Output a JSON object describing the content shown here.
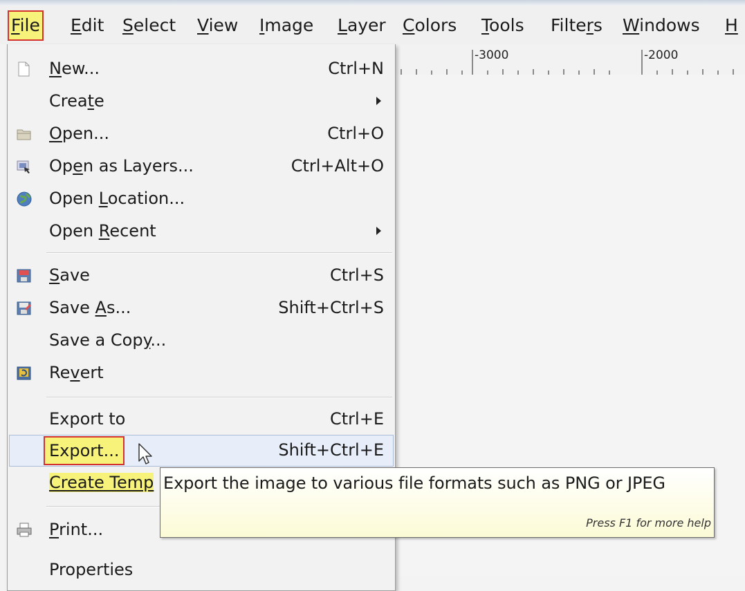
{
  "menubar": {
    "items": [
      {
        "pre": "",
        "key": "F",
        "post": "ile"
      },
      {
        "pre": "",
        "key": "E",
        "post": "dit"
      },
      {
        "pre": "",
        "key": "S",
        "post": "elect"
      },
      {
        "pre": "",
        "key": "V",
        "post": "iew"
      },
      {
        "pre": "",
        "key": "I",
        "post": "mage"
      },
      {
        "pre": "",
        "key": "L",
        "post": "ayer"
      },
      {
        "pre": "",
        "key": "C",
        "post": "olors"
      },
      {
        "pre": "",
        "key": "T",
        "post": "ools"
      },
      {
        "pre": "Filte",
        "key": "r",
        "post": "s"
      },
      {
        "pre": "",
        "key": "W",
        "post": "indows"
      },
      {
        "pre": "",
        "key": "H",
        "post": ""
      }
    ]
  },
  "ruler": {
    "labels": [
      "-3000",
      "-2000"
    ]
  },
  "file_menu": {
    "items": [
      {
        "pre": "",
        "key": "N",
        "post": "ew...",
        "accel": "Ctrl+N",
        "icon": "new-document-icon"
      },
      {
        "pre": "Crea",
        "key": "t",
        "post": "e",
        "accel": "",
        "submenu": true
      },
      {
        "pre": "",
        "key": "O",
        "post": "pen...",
        "accel": "Ctrl+O",
        "icon": "folder-open-icon"
      },
      {
        "pre": "Op",
        "key": "e",
        "post": "n as Layers...",
        "accel": "Ctrl+Alt+O",
        "icon": "open-as-layers-icon"
      },
      {
        "pre": "Open ",
        "key": "L",
        "post": "ocation...",
        "accel": "",
        "icon": "globe-icon"
      },
      {
        "pre": "Open ",
        "key": "R",
        "post": "ecent",
        "accel": "",
        "submenu": true
      },
      {
        "pre": "",
        "key": "S",
        "post": "ave",
        "accel": "Ctrl+S",
        "icon": "save-icon"
      },
      {
        "pre": "Save ",
        "key": "A",
        "post": "s...",
        "accel": "Shift+Ctrl+S",
        "icon": "save-as-icon"
      },
      {
        "pre": "Save a Cop",
        "key": "y",
        "post": "...",
        "accel": ""
      },
      {
        "pre": "Re",
        "key": "v",
        "post": "ert",
        "accel": "",
        "icon": "revert-icon"
      },
      {
        "pre": "Export to",
        "key": "",
        "post": "",
        "accel": "Ctrl+E"
      },
      {
        "pre": "Export...",
        "key": "",
        "post": "",
        "accel": "Shift+Ctrl+E"
      },
      {
        "pre": "Create Temp",
        "key": "",
        "post": "",
        "accel": ""
      },
      {
        "pre": "",
        "key": "P",
        "post": "rint...",
        "accel": "",
        "icon": "printer-icon"
      },
      {
        "pre": "Properties",
        "key": "",
        "post": "",
        "accel": ""
      }
    ]
  },
  "tooltip": {
    "text": "Export the image to various file formats such as PNG or JPEG",
    "help": "Press F1 for more help"
  }
}
